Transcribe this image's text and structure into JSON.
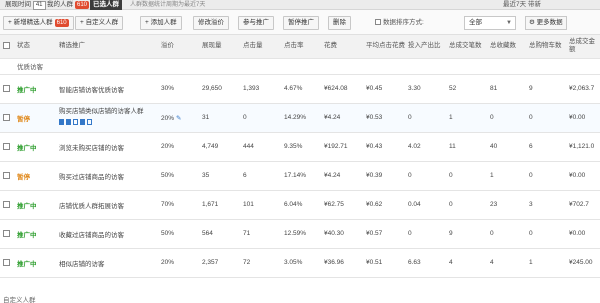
{
  "topbar": {
    "period_label": "展现时间",
    "period_value": "41",
    "tab_library": "我的人群",
    "tab_library_count": "610",
    "tab_selected": "已选人群",
    "tip": "人群数据统计周期为最近7天",
    "right_label": "最近7天",
    "right_extra": "带新"
  },
  "toolbar": {
    "btn_add": "+ 新增精选人群",
    "btn_add_count": "610",
    "btn_custom": "+ 自定义人群",
    "btn_add_crowd": "+ 添加人群",
    "btn_bid": "修改溢价",
    "btn_start": "参与推广",
    "btn_pause": "暂停推广",
    "btn_delete": "删除",
    "filter_label": "数据排序方式:",
    "select_value": "全部",
    "more_label": "更多数据"
  },
  "columns": [
    "状态",
    "精选推广",
    "溢价",
    "展现量",
    "点击量",
    "点击率",
    "花费",
    "平均点击花费",
    "投入产出比",
    "总成交笔数",
    "总收藏数",
    "总购物车数",
    "总成交金额"
  ],
  "group_label": "优质访客",
  "rows": [
    {
      "status": "推广中",
      "status_type": "on",
      "name": "智能店铺访客优质访客",
      "premium": "30%",
      "impr": "29,650",
      "clicks": "1,393",
      "ctr": "4.67%",
      "cost": "¥624.08",
      "cpc": "¥0.45",
      "roi": "3.30",
      "orders": "52",
      "favs": "81",
      "cart": "9",
      "gmv": "¥2,063.7"
    },
    {
      "status": "暂停",
      "status_type": "off",
      "name": "购买店铺类似店铺的访客人群",
      "premium": "20%",
      "impr": "31",
      "clicks": "0",
      "ctr": "14.29%",
      "cost": "¥4.24",
      "cpc": "¥0.53",
      "roi": "0",
      "orders": "1",
      "favs": "0",
      "cart": "0",
      "gmv": "¥0.00"
    },
    {
      "status": "推广中",
      "status_type": "on",
      "name": "浏览未购买店铺的访客",
      "premium": "20%",
      "impr": "4,749",
      "clicks": "444",
      "ctr": "9.35%",
      "cost": "¥192.71",
      "cpc": "¥0.43",
      "roi": "4.02",
      "orders": "11",
      "favs": "40",
      "cart": "6",
      "gmv": "¥1,121.0"
    },
    {
      "status": "暂停",
      "status_type": "off",
      "name": "购买过店铺商品的访客",
      "premium": "50%",
      "impr": "35",
      "clicks": "6",
      "ctr": "17.14%",
      "cost": "¥4.24",
      "cpc": "¥0.39",
      "roi": "0",
      "orders": "0",
      "favs": "1",
      "cart": "0",
      "gmv": "¥0.00"
    },
    {
      "status": "推广中",
      "status_type": "on",
      "name": "店铺优质人群拓展访客",
      "premium": "70%",
      "impr": "1,671",
      "clicks": "101",
      "ctr": "6.04%",
      "cost": "¥62.75",
      "cpc": "¥0.62",
      "roi": "0.04",
      "orders": "0",
      "favs": "23",
      "cart": "3",
      "gmv": "¥702.7"
    },
    {
      "status": "推广中",
      "status_type": "on",
      "name": "收藏过店铺商品的访客",
      "premium": "50%",
      "impr": "564",
      "clicks": "71",
      "ctr": "12.59%",
      "cost": "¥40.30",
      "cpc": "¥0.57",
      "roi": "0",
      "orders": "9",
      "favs": "0",
      "cart": "0",
      "gmv": "¥0.00"
    },
    {
      "status": "推广中",
      "status_type": "on",
      "name": "相似店铺的访客",
      "premium": "20%",
      "impr": "2,357",
      "clicks": "72",
      "ctr": "3.05%",
      "cost": "¥36.96",
      "cpc": "¥0.51",
      "roi": "6.63",
      "orders": "4",
      "favs": "4",
      "cart": "1",
      "gmv": "¥245.00"
    }
  ],
  "footer": "自定义人群"
}
